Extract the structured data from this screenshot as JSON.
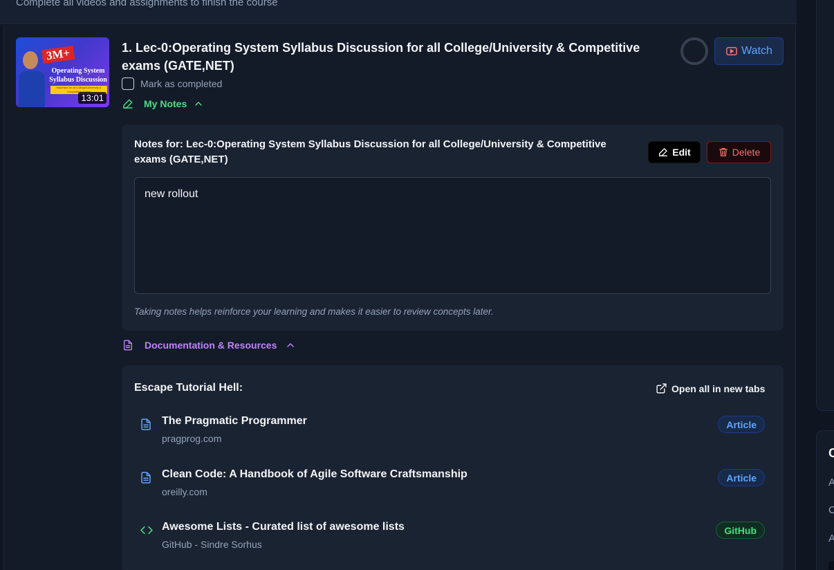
{
  "banner": {
    "subtitle": "Complete all videos and assignments to finish the course"
  },
  "lecture": {
    "index_title": "1. Lec-0:Operating System Syllabus Discussion for all College/University & Competitive exams (GATE,NET)",
    "duration": "13:01",
    "thumbnail": {
      "badge": "3M+",
      "title": "Operating System Syllabus Discussion",
      "strip": "Important for all College/University & Competitive exams"
    },
    "mark_completed_label": "Mark as completed",
    "watch_label": "Watch",
    "my_notes_label": "My Notes"
  },
  "notes": {
    "heading": "Notes for: Lec-0:Operating System Syllabus Discussion for all College/University & Competitive exams (GATE,NET)",
    "edit_label": "Edit",
    "delete_label": "Delete",
    "content": "new rollout",
    "hint": "Taking notes helps reinforce your learning and makes it easier to review concepts later."
  },
  "resources": {
    "toggle_label": "Documentation & Resources",
    "heading": "Escape Tutorial Hell:",
    "open_all_label": "Open all in new tabs",
    "items": [
      {
        "title": "The Pragmatic Programmer",
        "source": "pragprog.com",
        "type": "Article",
        "icon": "document-icon"
      },
      {
        "title": "Clean Code: A Handbook of Agile Software Craftsmanship",
        "source": "oreilly.com",
        "type": "Article",
        "icon": "document-icon"
      },
      {
        "title": "Awesome Lists - Curated list of awesome lists",
        "source": "GitHub - Sindre Sorhus",
        "type": "GitHub",
        "icon": "code-icon"
      }
    ]
  },
  "right_panel": {
    "heading": "C",
    "lines": [
      "A",
      "C",
      "A"
    ]
  },
  "colors": {
    "background": "#0f1521",
    "panel": "#1a2332",
    "notes_accent": "#4ade80",
    "resources_accent": "#c084fc",
    "watch_accent": "#60a5fa",
    "delete_accent": "#f87171"
  }
}
